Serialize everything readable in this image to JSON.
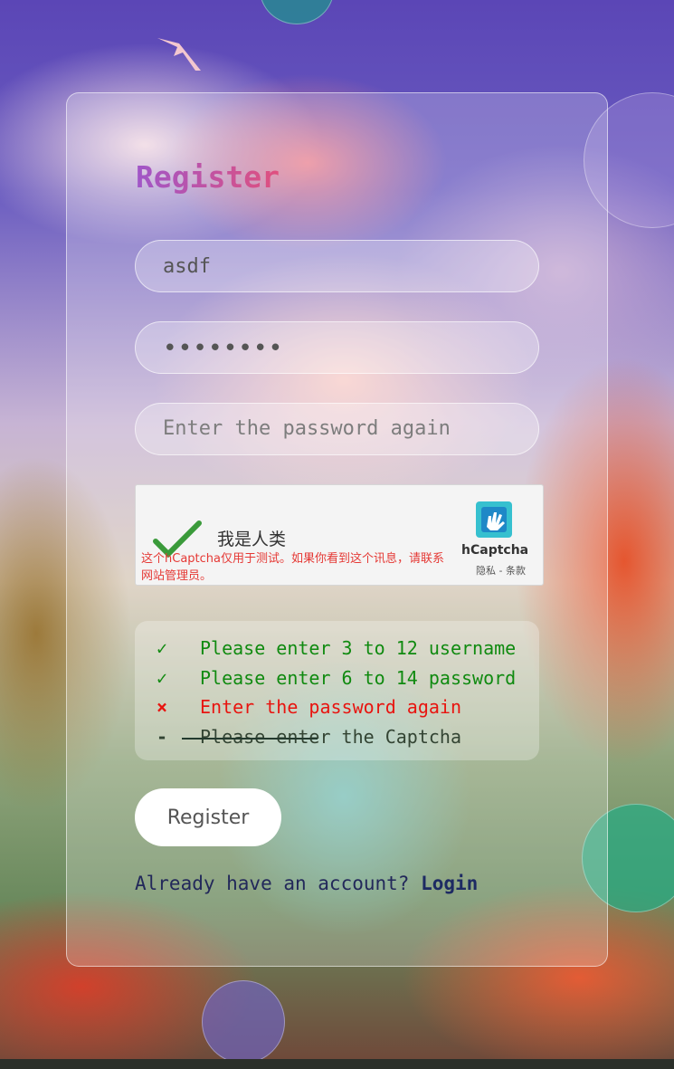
{
  "form": {
    "title": "Register",
    "username_value": "asdf",
    "password_dots": "••••••••",
    "confirm_placeholder": "Enter the password again",
    "submit_label": "Register"
  },
  "captcha": {
    "label": "我是人类",
    "warning": "这个hCaptcha仅用于测试。如果你看到这个讯息，请联系网站管理员。",
    "brand": "hCaptcha",
    "links": "隐私 - 条款"
  },
  "validation": [
    {
      "mark": "✓",
      "text": "Please enter 3 to 12 username",
      "status": "ok",
      "color": "#108a10"
    },
    {
      "mark": "✓",
      "text": "Please enter 6 to 14 password",
      "status": "ok",
      "color": "#108a10"
    },
    {
      "mark": "×",
      "text": "Enter the password again",
      "status": "error",
      "color": "#e8140f"
    },
    {
      "mark": "-",
      "text": "Please enter the Captcha",
      "status": "pending",
      "color": "#334433"
    }
  ],
  "footer": {
    "prompt": "Already have an account?",
    "login_link": "Login"
  },
  "icons": {
    "captcha_check": "checkmark-icon",
    "captcha_logo": "hcaptcha-logo-icon",
    "bird": "bird-icon"
  },
  "colors": {
    "title_gradient_start": "#a056c8",
    "title_gradient_end": "#e0507e",
    "valid": "#108a10",
    "invalid": "#e8140f",
    "link": "#1d2a63"
  }
}
